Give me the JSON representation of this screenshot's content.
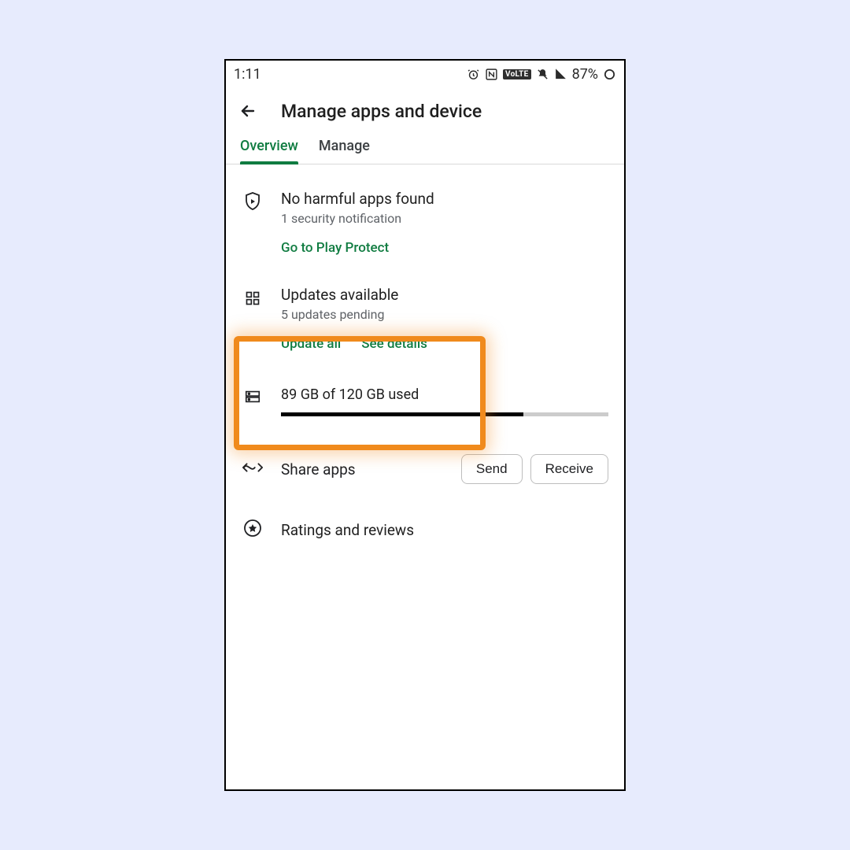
{
  "status": {
    "time": "1:11",
    "battery": "87%"
  },
  "header": {
    "title": "Manage apps and device"
  },
  "tabs": {
    "overview": "Overview",
    "manage": "Manage"
  },
  "protect": {
    "title": "No harmful apps found",
    "subtitle": "1 security notification",
    "action": "Go to Play Protect"
  },
  "updates": {
    "title": "Updates available",
    "subtitle": "5 updates pending",
    "update_all": "Update all",
    "see_details": "See details"
  },
  "storage": {
    "text": "89 GB of 120 GB used",
    "percent": 74
  },
  "share": {
    "title": "Share apps",
    "send": "Send",
    "receive": "Receive"
  },
  "ratings": {
    "title": "Ratings and reviews"
  }
}
